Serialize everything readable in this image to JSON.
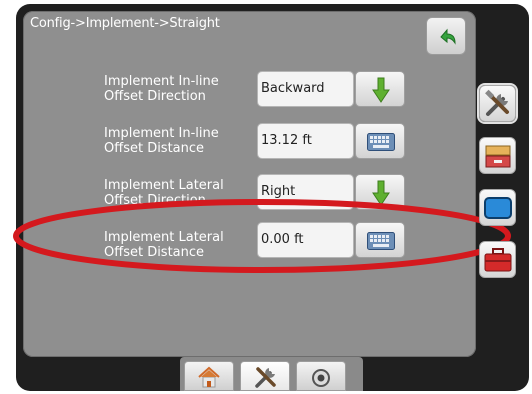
{
  "breadcrumb": "Config->Implement->Straight",
  "back_icon": "back-arrow-icon",
  "settings": [
    {
      "label_line1": "Implement In-line",
      "label_line2": "Offset Direction",
      "value": "Backward",
      "action_icon": "down-arrow-icon"
    },
    {
      "label_line1": "Implement In-line",
      "label_line2": "Offset Distance",
      "value": "13.12 ft",
      "action_icon": "keyboard-icon"
    },
    {
      "label_line1": "Implement Lateral",
      "label_line2": "Offset Direction",
      "value": "Right",
      "action_icon": "down-arrow-icon"
    },
    {
      "label_line1": "Implement Lateral",
      "label_line2": "Offset Distance",
      "value": "0.00 ft",
      "action_icon": "keyboard-icon"
    }
  ],
  "side_tabs": [
    "tools-icon",
    "console-icon",
    "screen-icon",
    "toolbox-icon"
  ],
  "bottom_tabs": [
    "home-icon",
    "tools-icon",
    "gauge-icon"
  ],
  "colors": {
    "panel": "#8f8f8f",
    "highlight": "#d4191e",
    "arrow_green": "#5fb030",
    "back_green": "#36a33e"
  }
}
